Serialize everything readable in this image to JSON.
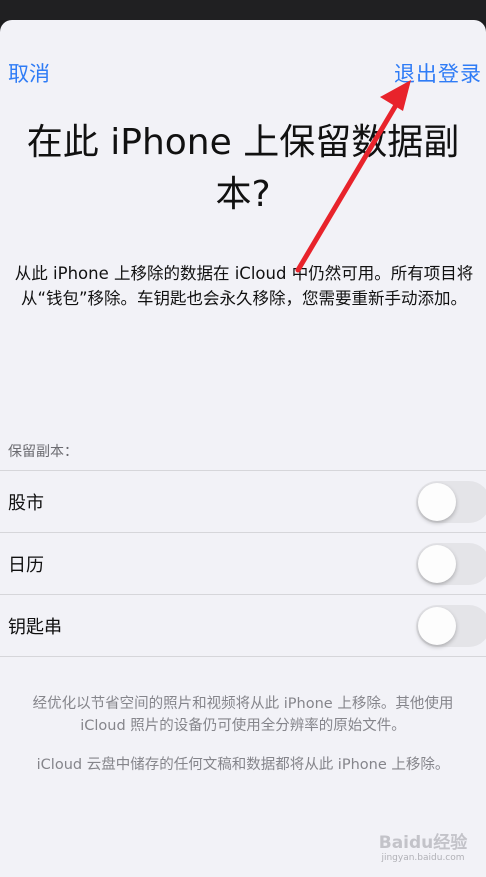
{
  "nav": {
    "cancel_label": "取消",
    "logout_label": "退出登录"
  },
  "title": "在此 iPhone 上保留数据副本?",
  "description": "从此 iPhone 上移除的数据在 iCloud 中仍然可用。所有项目将从“钱包”移除。车钥匙也会永久移除，您需要重新手动添加。",
  "keep_copy": {
    "header": "保留副本：",
    "items": [
      {
        "label": "股市",
        "enabled": false
      },
      {
        "label": "日历",
        "enabled": false
      },
      {
        "label": "钥匙串",
        "enabled": false
      }
    ]
  },
  "footer": {
    "photos_note": "经优化以节省空间的照片和视频将从此 iPhone 上移除。其他使用 iCloud 照片的设备仍可使用全分辨率的原始文件。",
    "drive_note": "iCloud 云盘中储存的任何文稿和数据都将从此 iPhone 上移除。"
  },
  "watermark": {
    "text": "Baidu经验",
    "sub": "jingyan.baidu.com"
  },
  "colors": {
    "accent": "#2f7cf6",
    "arrow": "#e8232b",
    "toggle_off": "#e4e4e8"
  }
}
